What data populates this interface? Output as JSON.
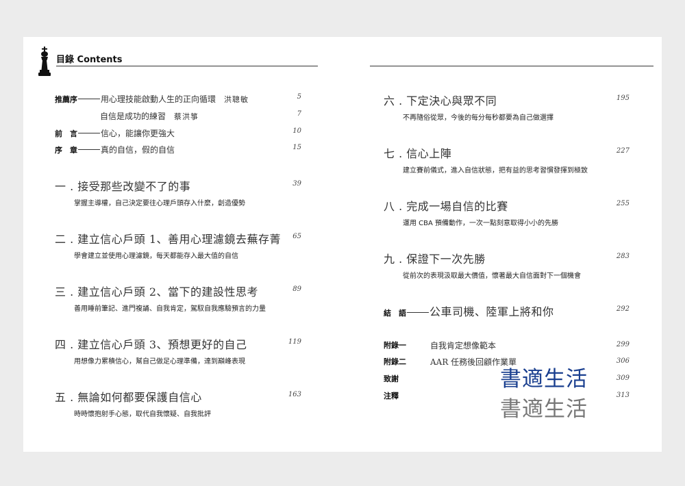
{
  "header": {
    "title": "目錄 Contents"
  },
  "front_matter": [
    {
      "label": "推薦序",
      "text": "用心理技能啟動人生的正向循環",
      "author": "洪聰敏",
      "page": "5"
    },
    {
      "label": "",
      "text": "自信是成功的練習",
      "author": "蔡洪箏",
      "page": "7"
    },
    {
      "label": "前　言",
      "text": "信心，能讓你更強大",
      "author": "",
      "page": "10"
    },
    {
      "label": "序　章",
      "text": "真的自信，假的自信",
      "author": "",
      "page": "15"
    }
  ],
  "chapters_left": [
    {
      "title": "一 . 接受那些改變不了的事",
      "desc": "掌握主導權，自己決定要往心理戶頭存入什麼，創造優勢",
      "page": "39"
    },
    {
      "title": "二 . 建立信心戶頭 1、善用心理濾鏡去蕪存菁",
      "desc": "學會建立並使用心理濾鏡，每天都能存入最大值的自信",
      "page": "65"
    },
    {
      "title": "三 . 建立信心戶頭 2、當下的建設性思考",
      "desc": "善用睡前筆記、進門複誦、自我肯定，駕馭自我應驗預言的力量",
      "page": "89"
    },
    {
      "title": "四 . 建立信心戶頭 3、預想更好的自己",
      "desc": "用想像力累積信心，幫自己做足心理準備，達到巔峰表現",
      "page": "119"
    },
    {
      "title": "五 . 無論如何都要保護自信心",
      "desc": "時時懷抱射手心態，取代自我懷疑、自我批評",
      "page": "163"
    }
  ],
  "chapters_right": [
    {
      "title": "六 . 下定決心與眾不同",
      "desc": "不再隨俗從眾，今後的每分每秒都要為自己做選擇",
      "page": "195"
    },
    {
      "title": "七 . 信心上陣",
      "desc": "建立賽前儀式，進入自信狀態，把有益的思考習慣發揮到極致",
      "page": "227"
    },
    {
      "title": "八 . 完成一場自信的比賽",
      "desc": "運用 CBA 預備動作，一次一點刻意取得小小的先勝",
      "page": "255"
    },
    {
      "title": "九 . 保證下一次先勝",
      "desc": "從前次的表現汲取最大價值，懷著最大自信面對下一個機會",
      "page": "283"
    }
  ],
  "conclusion": {
    "label": "結　語",
    "text": "公車司機、陸軍上將和你",
    "page": "292"
  },
  "back_matter": [
    {
      "label": "附錄一",
      "text": "自我肯定想像範本",
      "page": "299"
    },
    {
      "label": "附錄二",
      "text": "AAR 任務後回顧作業單",
      "page": "306"
    },
    {
      "label": "致謝",
      "text": "",
      "page": "309"
    },
    {
      "label": "注釋",
      "text": "",
      "page": "313"
    }
  ],
  "watermark": {
    "line1": "書適生活",
    "line2": "書適生活",
    "color1": "#1a3f8f",
    "color2": "#777777"
  },
  "icons": {
    "header_icon": "chess-king-icon"
  }
}
